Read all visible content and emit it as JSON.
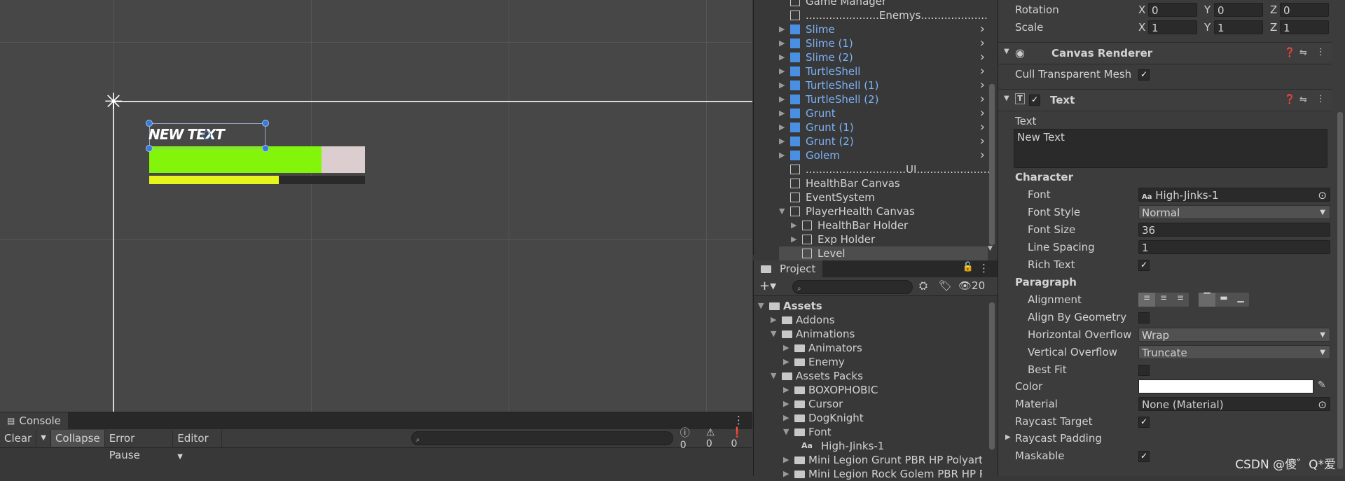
{
  "scene": {
    "canvas_text": "NEW TEXT",
    "health_fill": 0.8,
    "exp_fill": 0.6,
    "colors": {
      "health": "#83f50b",
      "health_bg": "#dccece",
      "exp": "#e6f51a"
    }
  },
  "console": {
    "tab": "Console",
    "clear": "Clear",
    "collapse": "Collapse",
    "error_pause": "Error Pause",
    "editor": "Editor",
    "count_info": "0",
    "count_warn": "0",
    "count_error": "0"
  },
  "hierarchy": {
    "items": [
      {
        "label": "Game Manager",
        "prefab": false
      },
      {
        "label": "......................Enemys....................",
        "prefab": false
      },
      {
        "label": "Slime",
        "prefab": true
      },
      {
        "label": "Slime (1)",
        "prefab": true
      },
      {
        "label": "Slime (2)",
        "prefab": true
      },
      {
        "label": "TurtleShell",
        "prefab": true
      },
      {
        "label": "TurtleShell (1)",
        "prefab": true
      },
      {
        "label": "TurtleShell (2)",
        "prefab": true
      },
      {
        "label": "Grunt",
        "prefab": true
      },
      {
        "label": "Grunt (1)",
        "prefab": true
      },
      {
        "label": "Grunt (2)",
        "prefab": true
      },
      {
        "label": "Golem",
        "prefab": true
      },
      {
        "label": "..............................UI......................",
        "prefab": false
      },
      {
        "label": "HealthBar Canvas",
        "prefab": false
      },
      {
        "label": "EventSystem",
        "prefab": false
      },
      {
        "label": "PlayerHealth Canvas",
        "prefab": false
      },
      {
        "label": "HealthBar Holder",
        "prefab": false
      },
      {
        "label": "Exp Holder",
        "prefab": false
      },
      {
        "label": "Level",
        "prefab": false
      }
    ]
  },
  "project": {
    "tab": "Project",
    "hidden_count": "20",
    "items": [
      {
        "label": "Assets"
      },
      {
        "label": "Addons"
      },
      {
        "label": "Animations"
      },
      {
        "label": "Animators"
      },
      {
        "label": "Enemy"
      },
      {
        "label": "Assets Packs"
      },
      {
        "label": "BOXOPHOBIC"
      },
      {
        "label": "Cursor"
      },
      {
        "label": "DogKnight"
      },
      {
        "label": "Font"
      },
      {
        "label": "High-Jinks-1"
      },
      {
        "label": "Mini Legion Grunt PBR HP Polyart"
      },
      {
        "label": "Mini Legion Rock Golem PBR HP Po"
      }
    ]
  },
  "inspector": {
    "rotation": {
      "label": "Rotation",
      "x": "0",
      "y": "0",
      "z": "0"
    },
    "scale": {
      "label": "Scale",
      "x": "1",
      "y": "1",
      "z": "1"
    },
    "axis": {
      "x": "X",
      "y": "Y",
      "z": "Z"
    },
    "canvas_renderer": {
      "title": "Canvas Renderer",
      "cull_label": "Cull Transparent Mesh"
    },
    "text_component": {
      "title": "Text",
      "text_label": "Text",
      "text_value": "New Text",
      "character": "Character",
      "font_label": "Font",
      "font_value": "High-Jinks-1",
      "font_style_label": "Font Style",
      "font_style_value": "Normal",
      "font_size_label": "Font Size",
      "font_size_value": "36",
      "line_spacing_label": "Line Spacing",
      "line_spacing_value": "1",
      "rich_text_label": "Rich Text",
      "paragraph": "Paragraph",
      "alignment_label": "Alignment",
      "align_geometry_label": "Align By Geometry",
      "h_overflow_label": "Horizontal Overflow",
      "h_overflow_value": "Wrap",
      "v_overflow_label": "Vertical Overflow",
      "v_overflow_value": "Truncate",
      "best_fit_label": "Best Fit",
      "color_label": "Color",
      "color_value": "#ffffff",
      "material_label": "Material",
      "material_value": "None (Material)",
      "raycast_target_label": "Raycast Target",
      "raycast_padding_label": "Raycast Padding",
      "maskable_label": "Maskable"
    }
  },
  "watermark": "CSDN @傻゛Q*爱"
}
